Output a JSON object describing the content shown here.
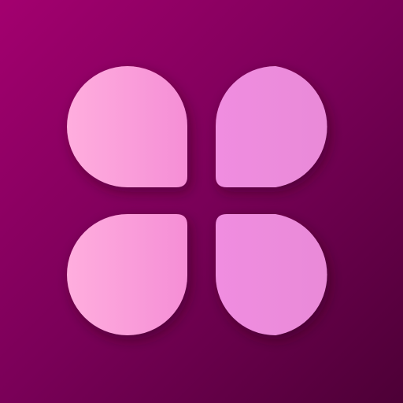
{
  "icon": {
    "name": "four-petal-flower-app-icon",
    "background_gradient": [
      "#a3006f",
      "#7a0058",
      "#4d0036"
    ],
    "petal_left_colors": [
      "#ffaede",
      "#f58ed6"
    ],
    "petal_right_colors": [
      "#f08de0",
      "#e98ad8"
    ],
    "petals": [
      {
        "name": "petal-top-left"
      },
      {
        "name": "petal-top-right"
      },
      {
        "name": "petal-bottom-left"
      },
      {
        "name": "petal-bottom-right"
      }
    ]
  }
}
